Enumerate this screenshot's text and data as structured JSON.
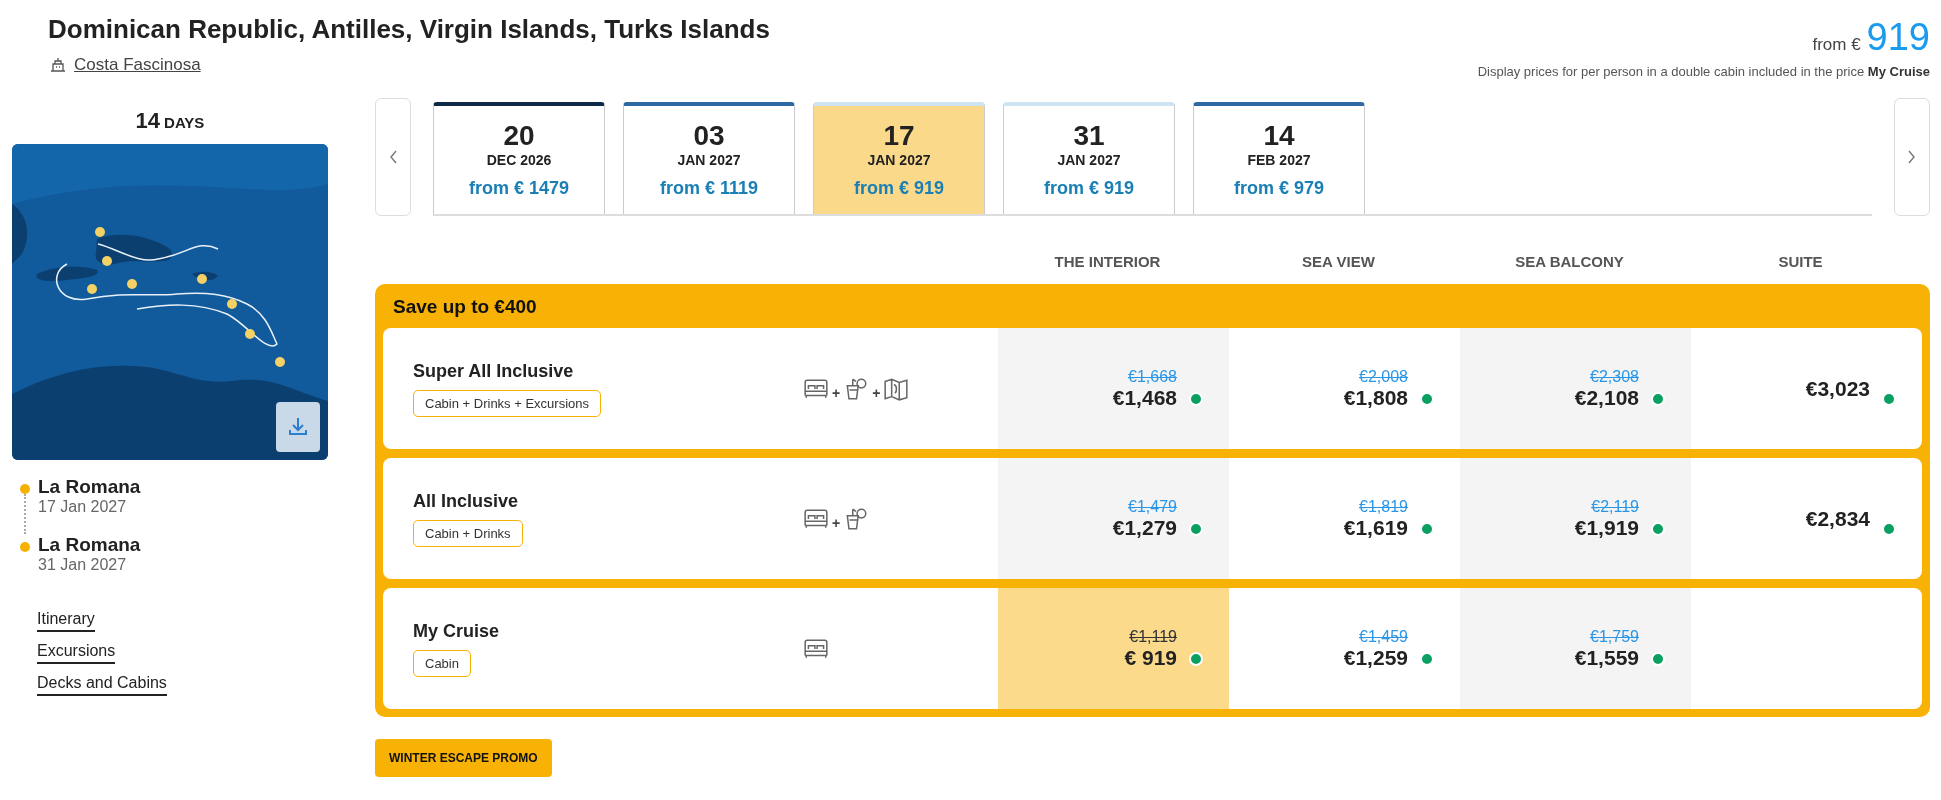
{
  "header": {
    "title": "Dominican Republic, Antilles, Virgin Islands, Turks Islands",
    "ship": "Costa Fascinosa",
    "price_prefix": "from €",
    "price": "919",
    "note": "Display prices for per person in a double cabin included in the price **My Cruise**"
  },
  "side": {
    "days_number": "14",
    "days_label": "DAYS",
    "map": {
      "kind": "picture"
    },
    "ports": [
      {
        "name": "La Romana",
        "date": "17 Jan 2027"
      },
      {
        "name": "La Romana",
        "date": "31 Jan 2027"
      }
    ],
    "links": [
      "Itinerary",
      "Excursions",
      "Decks and Cabins"
    ]
  },
  "dates": [
    {
      "day": "20",
      "month": "DEC 2026",
      "price": "from € 1479",
      "selected": false,
      "color": "#0d2a47"
    },
    {
      "day": "03",
      "month": "JAN 2027",
      "price": "from € 1119",
      "selected": false,
      "color": "#2d6aa3"
    },
    {
      "day": "17",
      "month": "JAN 2027",
      "price": "from € 919",
      "selected": true,
      "color": "#cfe4f3"
    },
    {
      "day": "31",
      "month": "JAN 2027",
      "price": "from € 919",
      "selected": false,
      "color": "#cfe4f3"
    },
    {
      "day": "14",
      "month": "FEB 2027",
      "price": "from € 979",
      "selected": false,
      "color": "#2d6aa3"
    }
  ],
  "table": {
    "columns": [
      "THE INTERIOR",
      "SEA VIEW",
      "SEA BALCONY",
      "SUITE"
    ],
    "banner": "Save up to €400",
    "rows": [
      {
        "name": "Super All Inclusive",
        "tag": "Cabin + Drinks + Excursions",
        "icons": [
          {
            "kind": "bed"
          },
          {
            "kind": "drink",
            "joiner": "+"
          },
          {
            "kind": "map",
            "joiner": "+"
          }
        ],
        "cells": [
          {
            "old": "€1,668",
            "price": "€1,468",
            "selected": false,
            "available": true
          },
          {
            "old": "€2,008",
            "price": "€1,808",
            "selected": false,
            "available": true
          },
          {
            "old": "€2,308",
            "price": "€2,108",
            "selected": false,
            "available": true
          },
          {
            "price": "€3,023",
            "selected": false,
            "available": true
          }
        ]
      },
      {
        "name": "All Inclusive",
        "tag": "Cabin + Drinks",
        "icons": [
          {
            "kind": "bed"
          },
          {
            "kind": "drink",
            "joiner": "+"
          }
        ],
        "cells": [
          {
            "old": "€1,479",
            "price": "€1,279",
            "selected": false,
            "available": true
          },
          {
            "old": "€1,819",
            "price": "€1,619",
            "selected": false,
            "available": true
          },
          {
            "old": "€2,119",
            "price": "€1,919",
            "selected": false,
            "available": true
          },
          {
            "price": "€2,834",
            "selected": false,
            "available": true
          }
        ]
      },
      {
        "name": "My Cruise",
        "tag": "Cabin",
        "icons": [
          {
            "kind": "bed"
          }
        ],
        "cells": [
          {
            "old": "€1,119",
            "price": "€ 919",
            "selected": true,
            "available": true
          },
          {
            "old": "€1,459",
            "price": "€1,259",
            "selected": false,
            "available": true
          },
          {
            "old": "€1,759",
            "price": "€1,559",
            "selected": false,
            "available": true
          }
        ]
      }
    ]
  },
  "promo": "WINTER ESCAPE PROMO"
}
